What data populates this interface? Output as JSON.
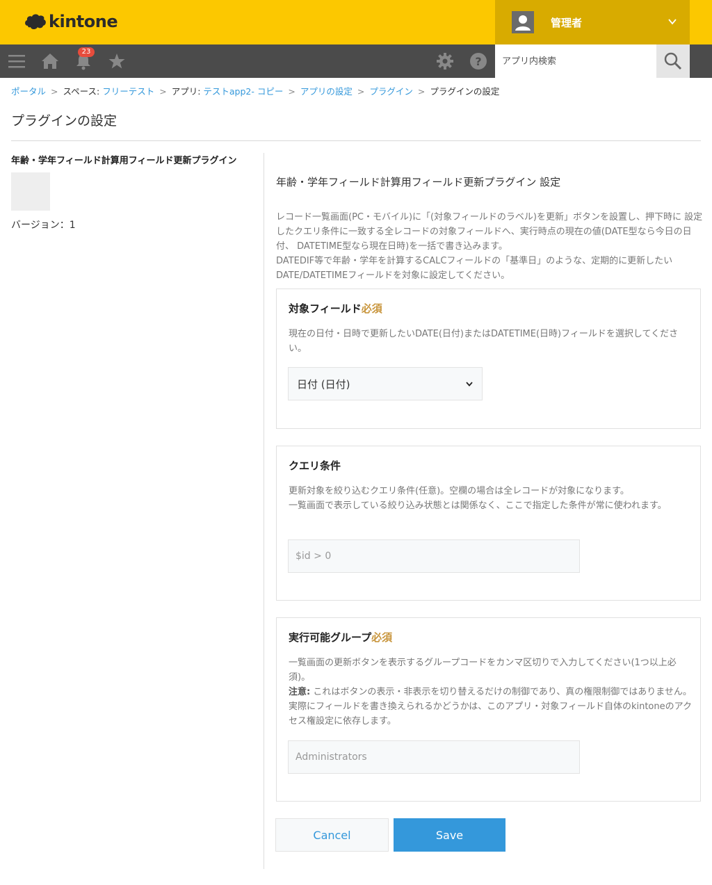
{
  "header": {
    "logo_text": "kintone",
    "user_name": "管理者",
    "notification_count": "23",
    "search_placeholder": "アプリ内検索"
  },
  "breadcrumb": {
    "items": [
      {
        "prefix": "",
        "label": "ポータル"
      },
      {
        "prefix": "スペース: ",
        "label": "フリーテスト"
      },
      {
        "prefix": "アプリ: ",
        "label": "テストapp2- コピー"
      },
      {
        "prefix": "",
        "label": "アプリの設定"
      },
      {
        "prefix": "",
        "label": "プラグイン"
      },
      {
        "prefix": "",
        "label": "プラグインの設定"
      }
    ],
    "separator": ">"
  },
  "page": {
    "title": "プラグインの設定"
  },
  "plugin": {
    "name": "年齢・学年フィールド計算用フィールド更新プラグイン",
    "version": "バージョン：1"
  },
  "settings": {
    "title": "年齢・学年フィールド計算用フィールド更新プラグイン 設定",
    "intro_1": "レコード一覧画面(PC・モバイル)に「(対象フィールドのラベル)を更新」ボタンを設置し、押下時に 設定したクエリ条件に一致する全レコードの対象フィールドへ、実行時点の現在の値(DATE型なら今日の日付、 DATETIME型なら現在日時)を一括で書き込みます。",
    "intro_2": "DATEDIF等で年齢・学年を計算するCALCフィールドの「基準日」のような、定期的に更新したい DATE/DATETIMEフィールドを対象に設定してください。",
    "required_label": "必須",
    "target_field": {
      "label": "対象フィールド",
      "description": "現在の日付・日時で更新したいDATE(日付)またはDATETIME(日時)フィールドを選択してください。",
      "selected": "日付 (日付)"
    },
    "query": {
      "label": "クエリ条件",
      "description_1": "更新対象を絞り込むクエリ条件(任意)。空欄の場合は全レコードが対象になります。",
      "description_2": "一覧画面で表示している絞り込み状態とは関係なく、ここで指定した条件が常に使われます。",
      "placeholder": "$id > 0"
    },
    "groups": {
      "label": "実行可能グループ",
      "description_1": "一覧画面の更新ボタンを表示するグループコードをカンマ区切りで入力してください(1つ以上必須)。",
      "note_label": "注意:",
      "note_text": " これはボタンの表示・非表示を切り替えるだけの制御であり、真の権限制御ではありません。 実際にフィールドを書き換えられるかどうかは、このアプリ・対象フィールド自体のkintoneのアクセス権設定に依存します。",
      "placeholder": "Administrators"
    }
  },
  "buttons": {
    "cancel": "Cancel",
    "save": "Save"
  },
  "colors": {
    "header_yellow": "#fcc800",
    "user_box": "#d8ab00",
    "nav_dark": "#4b4b4b",
    "link_blue": "#3498db",
    "required_gold": "#c8953c",
    "badge_red": "#e74c3c"
  },
  "icons": [
    "kintone-logo-icon",
    "user-avatar-icon",
    "chevron-down-icon",
    "menu-icon",
    "home-icon",
    "bell-icon",
    "star-icon",
    "gear-icon",
    "help-icon",
    "search-icon"
  ]
}
